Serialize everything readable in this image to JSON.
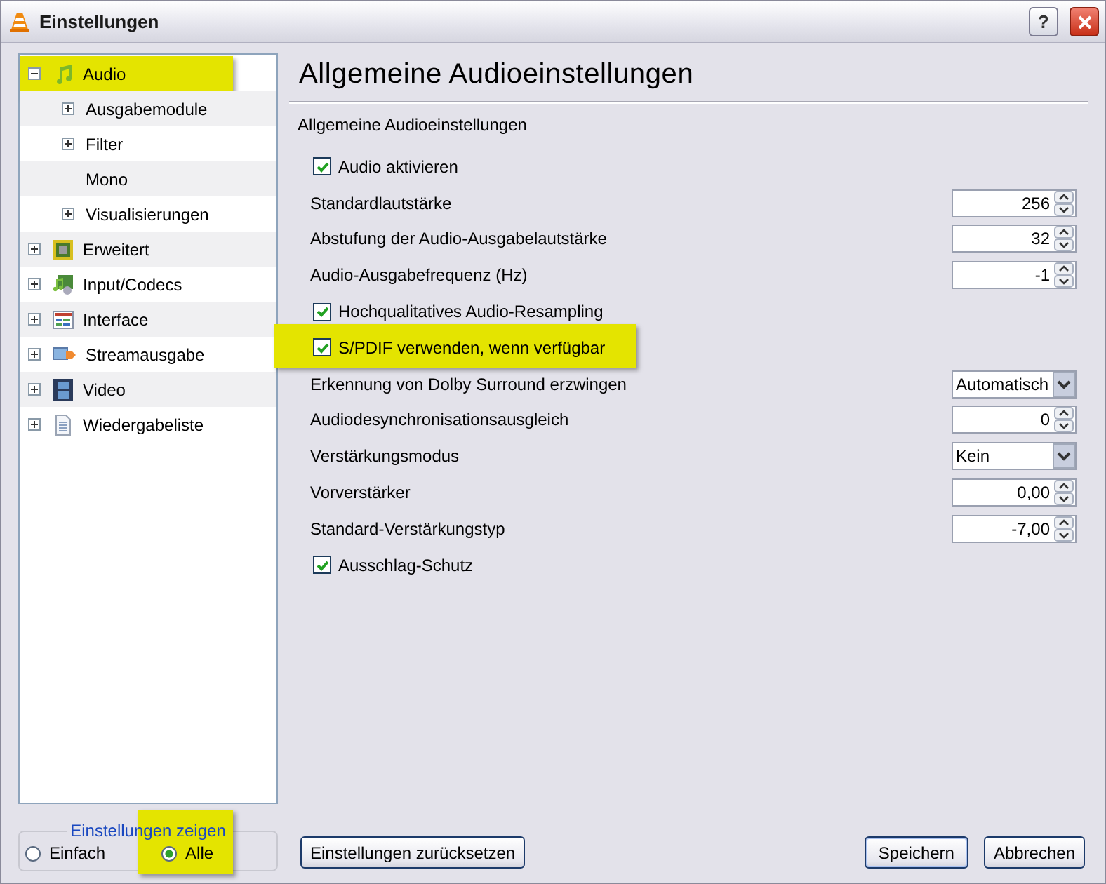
{
  "window": {
    "title": "Einstellungen",
    "help_button": "?"
  },
  "tree": [
    {
      "label": "Audio",
      "expandable": true,
      "highlighted": true,
      "children": [
        {
          "label": "Ausgabemodule",
          "expandable": true,
          "highlighted": false
        },
        {
          "label": "Filter",
          "expandable": true,
          "highlighted": false
        },
        {
          "label": "Mono",
          "expandable": false,
          "highlighted": false
        },
        {
          "label": "Visualisierungen",
          "expandable": true,
          "highlighted": false
        }
      ]
    },
    {
      "label": "Erweitert",
      "expandable": true,
      "highlighted": false
    },
    {
      "label": "Input/Codecs",
      "expandable": true,
      "highlighted": false
    },
    {
      "label": "Interface",
      "expandable": true,
      "highlighted": false
    },
    {
      "label": "Streamausgabe",
      "expandable": true,
      "highlighted": false
    },
    {
      "label": "Video",
      "expandable": true,
      "highlighted": false
    },
    {
      "label": "Wiedergabeliste",
      "expandable": true,
      "highlighted": false
    }
  ],
  "show_settings": {
    "legend": "Einstellungen zeigen",
    "options": [
      {
        "label": "Einfach",
        "selected": false,
        "highlighted": false
      },
      {
        "label": "Alle",
        "selected": true,
        "highlighted": true
      }
    ]
  },
  "page": {
    "title": "Allgemeine Audioeinstellungen",
    "subtitle": "Allgemeine Audioeinstellungen"
  },
  "settings": [
    {
      "kind": "checkbox",
      "label": "Audio aktivieren",
      "checked": true,
      "highlighted": false
    },
    {
      "kind": "spin",
      "label": "Standardlautstärke",
      "value": "256",
      "highlighted": false
    },
    {
      "kind": "spin",
      "label": "Abstufung der Audio-Ausgabelautstärke",
      "value": "32",
      "highlighted": false
    },
    {
      "kind": "spin",
      "label": "Audio-Ausgabefrequenz (Hz)",
      "value": "-1",
      "highlighted": false
    },
    {
      "kind": "checkbox",
      "label": "Hochqualitatives Audio-Resampling",
      "checked": true,
      "highlighted": false
    },
    {
      "kind": "checkbox",
      "label": "S/PDIF verwenden, wenn verfügbar",
      "checked": true,
      "highlighted": true
    },
    {
      "kind": "combo",
      "label": "Erkennung von Dolby Surround erzwingen",
      "value": "Automatisch",
      "highlighted": false
    },
    {
      "kind": "spin",
      "label": "Audiodesynchronisationsausgleich",
      "value": "0",
      "highlighted": false
    },
    {
      "kind": "combo",
      "label": "Verstärkungsmodus",
      "value": "Kein",
      "highlighted": false
    },
    {
      "kind": "spin",
      "label": "Vorverstärker",
      "value": "0,00",
      "highlighted": false
    },
    {
      "kind": "spin",
      "label": "Standard-Verstärkungstyp",
      "value": "-7,00",
      "highlighted": false
    },
    {
      "kind": "checkbox",
      "label": "Ausschlag-Schutz",
      "checked": true,
      "highlighted": false
    }
  ],
  "buttons": {
    "reset": "Einstellungen zurücksetzen",
    "save": "Speichern",
    "cancel": "Abbrechen"
  }
}
